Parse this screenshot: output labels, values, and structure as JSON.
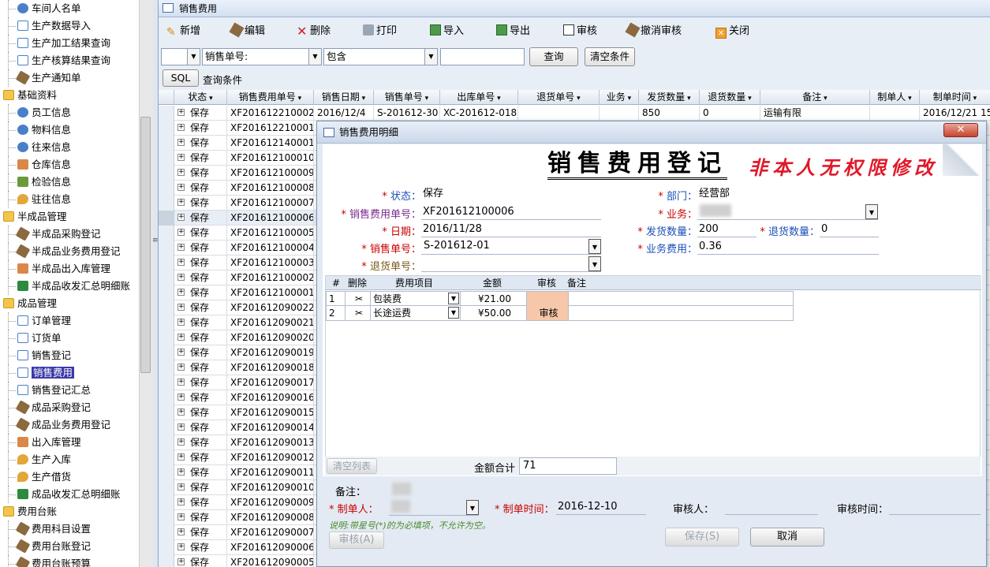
{
  "sidebar": {
    "items": [
      {
        "type": "leaf",
        "icon": "people-icon",
        "label": "车间人名单"
      },
      {
        "type": "leaf",
        "icon": "import-icon",
        "label": "生产数据导入"
      },
      {
        "type": "leaf",
        "icon": "document-icon",
        "label": "生产加工结果查询"
      },
      {
        "type": "leaf",
        "icon": "document-icon",
        "label": "生产核算结果查询"
      },
      {
        "type": "leaf",
        "icon": "tool-icon",
        "label": "生产通知单"
      },
      {
        "type": "cat",
        "icon": "folder-icon",
        "label": "基础资料"
      },
      {
        "type": "leaf",
        "icon": "people-icon",
        "label": "员工信息"
      },
      {
        "type": "leaf",
        "icon": "people-icon",
        "label": "物料信息"
      },
      {
        "type": "leaf",
        "icon": "people-icon",
        "label": "往来信息"
      },
      {
        "type": "leaf",
        "icon": "house-icon",
        "label": "仓库信息"
      },
      {
        "type": "leaf",
        "icon": "check-icon",
        "label": "检验信息"
      },
      {
        "type": "leaf",
        "icon": "pin-icon",
        "label": "驻往信息"
      },
      {
        "type": "cat",
        "icon": "folder-icon",
        "label": "半成品管理"
      },
      {
        "type": "leaf",
        "icon": "tool-icon",
        "label": "半成品采购登记"
      },
      {
        "type": "leaf",
        "icon": "tool-icon",
        "label": "半成品业务费用登记"
      },
      {
        "type": "leaf",
        "icon": "house-icon",
        "label": "半成品出入库管理"
      },
      {
        "type": "leaf",
        "icon": "sheet-icon",
        "label": "半成品收发汇总明细账"
      },
      {
        "type": "cat",
        "icon": "folder-icon",
        "label": "成品管理"
      },
      {
        "type": "leaf",
        "icon": "document-icon",
        "label": "订单管理"
      },
      {
        "type": "leaf",
        "icon": "document-icon",
        "label": "订货单"
      },
      {
        "type": "leaf",
        "icon": "document-icon",
        "label": "销售登记"
      },
      {
        "type": "leaf",
        "icon": "document-icon",
        "label": "销售费用",
        "selected": true
      },
      {
        "type": "leaf",
        "icon": "document-icon",
        "label": "销售登记汇总"
      },
      {
        "type": "leaf",
        "icon": "tool-icon",
        "label": "成品采购登记"
      },
      {
        "type": "leaf",
        "icon": "tool-icon",
        "label": "成品业务费用登记"
      },
      {
        "type": "leaf",
        "icon": "house-icon",
        "label": "出入库管理"
      },
      {
        "type": "leaf",
        "icon": "pin-icon",
        "label": "生产入库"
      },
      {
        "type": "leaf",
        "icon": "pin-icon",
        "label": "生产借货"
      },
      {
        "type": "leaf",
        "icon": "sheet-icon",
        "label": "成品收发汇总明细账"
      },
      {
        "type": "cat",
        "icon": "folder-icon",
        "label": "费用台账"
      },
      {
        "type": "leaf",
        "icon": "tool-icon",
        "label": "费用科目设置"
      },
      {
        "type": "leaf",
        "icon": "tool-icon",
        "label": "费用台账登记"
      },
      {
        "type": "leaf",
        "icon": "tool-icon",
        "label": "费用台账预算"
      }
    ]
  },
  "window": {
    "title": "销售费用"
  },
  "toolbar": {
    "new": "新增",
    "edit": "编辑",
    "delete": "删除",
    "print": "打印",
    "import": "导入",
    "export": "导出",
    "audit": "审核",
    "unaudit": "撤消审核",
    "close": "关闭"
  },
  "filter": {
    "field": "销售单号:",
    "op": "包含",
    "value": "",
    "query": "查询",
    "clear": "清空条件",
    "sql": "SQL",
    "condition": "查询条件"
  },
  "grid": {
    "headers": [
      "状态",
      "销售费用单号",
      "销售日期",
      "销售单号",
      "出库单号",
      "退货单号",
      "业务",
      "发货数量",
      "退货数量",
      "备注",
      "制单人",
      "制单时间"
    ],
    "first_row": {
      "status": "保存",
      "no": "XF201612210002",
      "date": "2016/12/4",
      "sale": "S-201612-30",
      "out": "XC-201612-018",
      "qty": "850",
      "ret": "0",
      "remark": "运输有限",
      "time": "2016/12/21 15:"
    },
    "rows": [
      "XF201612210001",
      "XF201612140001",
      "XF201612100010",
      "XF201612100009",
      "XF201612100008",
      "XF201612100007",
      "XF201612100006",
      "XF201612100005",
      "XF201612100004",
      "XF201612100003",
      "XF201612100002",
      "XF201612100001",
      "XF201612090022",
      "XF201612090021",
      "XF201612090020",
      "XF201612090019",
      "XF201612090018",
      "XF201612090017",
      "XF201612090016",
      "XF201612090015",
      "XF201612090014",
      "XF201612090013",
      "XF201612090012",
      "XF201612090011",
      "XF201612090010",
      "XF201612090009",
      "XF201612090008",
      "XF201612090007",
      "XF201612090006",
      "XF201612090005"
    ],
    "row_status": "保存",
    "current_index": 6
  },
  "dialog": {
    "title": "销售费用明细",
    "heading": "销售费用登记",
    "warning": "非本人无权限修改",
    "close": "✕",
    "status_label": "状态：",
    "status": "保存",
    "no_label": "销售费用单号：",
    "no": "XF201612100006",
    "date_label": "日期：",
    "date": "2016/11/28",
    "sale_label": "销售单号：",
    "sale": "S-201612-01",
    "return_label": "退货单号：",
    "return": "",
    "dept_label": "部门：",
    "dept": "经营部",
    "biz_label": "业务：",
    "ship_label": "发货数量：",
    "ship": "200",
    "retqty_label": "退货数量：",
    "retqty": "0",
    "fee_label": "业务费用：",
    "fee": "0.36",
    "sub_headers": [
      "#",
      "删除",
      "费用项目",
      "金额",
      "审核",
      "备注"
    ],
    "sub_rows": [
      {
        "no": "1",
        "item": "包装费",
        "amount": "¥21.00",
        "audit": ""
      },
      {
        "no": "2",
        "item": "长途运费",
        "amount": "¥50.00",
        "audit": "审核"
      }
    ],
    "clear_list": "清空列表",
    "sum_label": "金额合计",
    "sum": "71",
    "remark_label": "备注：",
    "maker_label": "制单人：",
    "make_time_label": "制单时间：",
    "make_time": "2016-12-10",
    "auditor_label": "审核人：",
    "audit_time_label": "审核时间：",
    "note": "说明:带星号(*)的为必填项，不允许为空。",
    "audit_btn": "审核(A)",
    "save_btn": "保存(S)",
    "cancel_btn": "取消"
  }
}
